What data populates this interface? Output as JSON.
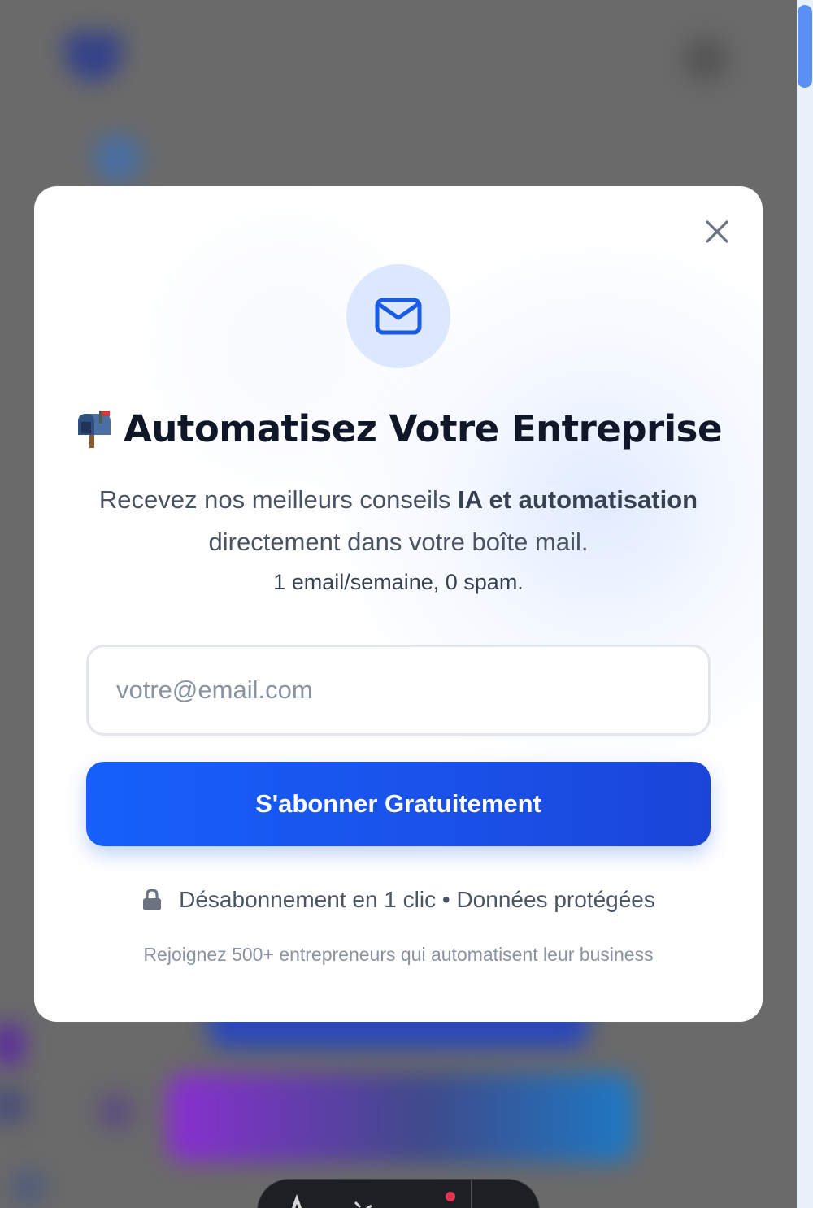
{
  "modal": {
    "title": "Automatisez Votre Entreprise",
    "subtitle_part1": "Recevez nos meilleurs conseils ",
    "subtitle_bold": "IA et automatisation",
    "subtitle_part2": " directement dans votre boîte mail.",
    "note": "1 email/semaine, 0 spam.",
    "email_input": {
      "placeholder": "votre@email.com",
      "value": ""
    },
    "subscribe_button_label": "S'abonner Gratuitement",
    "privacy_text": "Désabonnement en 1 clic • Données protégées",
    "social_proof": "Rejoignez 500+ entrepreneurs qui automatisent leur business"
  },
  "icons": {
    "close": "close-icon",
    "envelope": "envelope-icon",
    "mailbox": "mailbox-icon",
    "lock": "lock-icon"
  },
  "colors": {
    "accent": "#1660fb",
    "icon_circle_bg": "#dbe8fe",
    "title": "#0f1729",
    "overlay": "#6a6a6a"
  }
}
